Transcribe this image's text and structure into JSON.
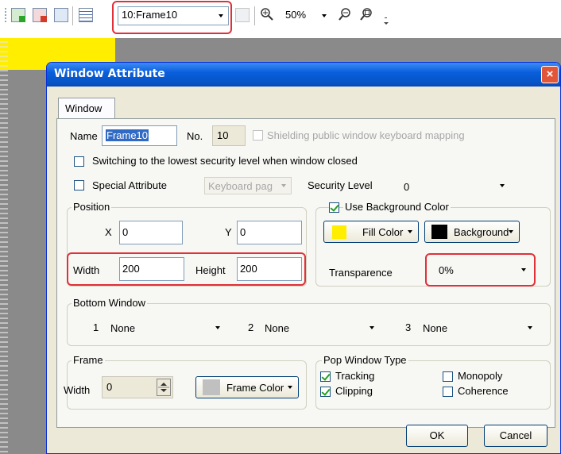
{
  "toolbar": {
    "frame_select": "10:Frame10",
    "zoom_select": "50%"
  },
  "dialog": {
    "title": "Window Attribute",
    "close_glyph": "×",
    "tab": "Window",
    "name_label": "Name",
    "name_value": "Frame10",
    "no_label": "No.",
    "no_value": "10",
    "shielding_label": "Shielding public window keyboard mapping",
    "switch_label": "Switching to the lowest security level when window closed",
    "special_label": "Special Attribute",
    "keyboard_page": "Keyboard pag",
    "security_label": "Security Level",
    "security_value": "0",
    "position": {
      "title": "Position",
      "x_label": "X",
      "x_value": "0",
      "y_label": "Y",
      "y_value": "0",
      "width_label": "Width",
      "width_value": "200",
      "height_label": "Height",
      "height_value": "200"
    },
    "background": {
      "use_label": "Use Background Color",
      "fill_label": "Fill Color",
      "fill_color": "#ffee00",
      "bg_label": "Background",
      "bg_color": "#000000",
      "transparence_label": "Transparence",
      "transparence_value": "0%"
    },
    "bottom": {
      "title": "Bottom Window",
      "items": [
        {
          "num": "1",
          "value": "None"
        },
        {
          "num": "2",
          "value": "None"
        },
        {
          "num": "3",
          "value": "None"
        }
      ]
    },
    "frame": {
      "title": "Frame",
      "width_label": "Width",
      "width_value": "0",
      "color_label": "Frame Color",
      "color": "#c0c0c0"
    },
    "popup": {
      "title": "Pop Window Type",
      "tracking": "Tracking",
      "clipping": "Clipping",
      "monopoly": "Monopoly",
      "coherence": "Coherence"
    },
    "ok": "OK",
    "cancel": "Cancel"
  }
}
